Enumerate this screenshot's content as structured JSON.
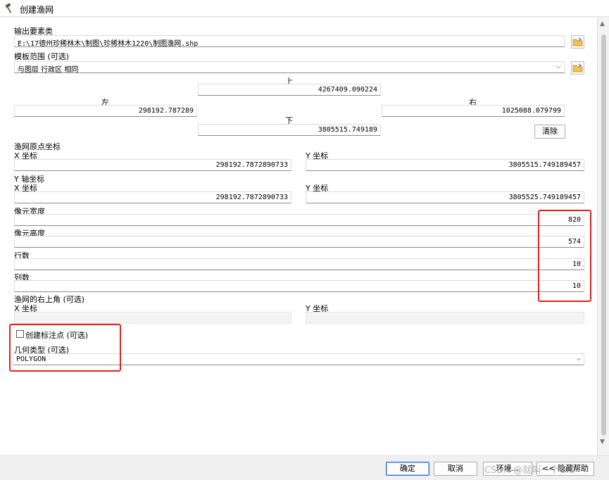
{
  "window": {
    "title": "创建渔网"
  },
  "output": {
    "label": "输出要素类",
    "path": "E:\\17德州珍稀林木\\制图\\珍稀林木1220\\制图渔网.shp"
  },
  "template": {
    "label": "模板范围 (可选)",
    "value": "与图层 行政区 相同",
    "top_label": "上",
    "top_value": "4267409.090224",
    "left_label": "左",
    "left_value": "298192.787289",
    "right_label": "右",
    "right_value": "1025088.079799",
    "bottom_label": "下",
    "bottom_value": "3805515.749189",
    "clear_button": "清除"
  },
  "origin": {
    "label": "渔网原点坐标",
    "x_label": "X 坐标",
    "x_value": "298192.7872890733",
    "y_label": "Y 坐标",
    "y_value": "3805515.749189457"
  },
  "yaxis": {
    "label": "Y 轴坐标",
    "x_label": "X 坐标",
    "x_value": "298192.7872890733",
    "y_label": "Y 坐标",
    "y_value": "3805525.749189457"
  },
  "cell_width": {
    "label": "像元宽度",
    "value": "820"
  },
  "cell_height": {
    "label": "像元高度",
    "value": "574"
  },
  "rows": {
    "label": "行数",
    "value": "10"
  },
  "cols": {
    "label": "列数",
    "value": "10"
  },
  "corner": {
    "label": "渔网的右上角 (可选)",
    "x_label": "X 坐标",
    "y_label": "Y 坐标"
  },
  "labels_option": {
    "label": "创建标注点 (可选)",
    "checked": false
  },
  "geometry": {
    "label": "几何类型 (可选)",
    "value": "POLYGON"
  },
  "buttons": {
    "ok": "确定",
    "cancel": "取消",
    "env": "环境...",
    "help": "<< 隐藏帮助"
  },
  "watermark": "CSDN @就叫一个GIS",
  "colors": {
    "highlight": "#e1221b",
    "accent": "#2f73c8"
  },
  "icons": {
    "title": "hammer-icon",
    "folder": "folder-open-icon"
  }
}
